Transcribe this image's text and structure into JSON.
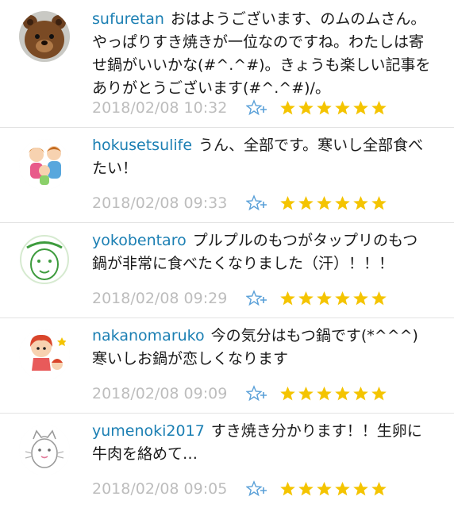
{
  "comments": [
    {
      "user": "sufuretan",
      "text": "おはようございます、のムのムさん。やっぱりすき焼きが一位なのですね。わたしは寄せ鍋がいいかな(#^.^#)。きょうも楽しい記事をありがとうございます(#^.^#)/。",
      "time": "2018/02/08 10:32",
      "stars": 6,
      "avatar_icon": "teddy-bear-avatar"
    },
    {
      "user": "hokusetsulife",
      "text": "うん、全部です。寒いし全部食べたい！",
      "time": "2018/02/08 09:33",
      "stars": 6,
      "avatar_icon": "family-avatar"
    },
    {
      "user": "yokobentaro",
      "text": "プルプルのもつがタップリのもつ鍋が非常に食べたくなりました（汗）！！！",
      "time": "2018/02/08 09:29",
      "stars": 6,
      "avatar_icon": "face-sketch-avatar"
    },
    {
      "user": "nakanomaruko",
      "text": "今の気分はもつ鍋です(*^^^)寒いしお鍋が恋しくなります",
      "time": "2018/02/08 09:09",
      "stars": 6,
      "avatar_icon": "girl-character-avatar"
    },
    {
      "user": "yumenoki2017",
      "text": "すき焼き分かります！！生卵に牛肉を絡めて…",
      "time": "2018/02/08 09:05",
      "stars": 6,
      "avatar_icon": "cat-sketch-avatar"
    }
  ],
  "colors": {
    "username": "#1b7fb3",
    "timestamp": "#bdbdbd",
    "star": "#f4c400",
    "add_star": "#5aa0d8"
  }
}
